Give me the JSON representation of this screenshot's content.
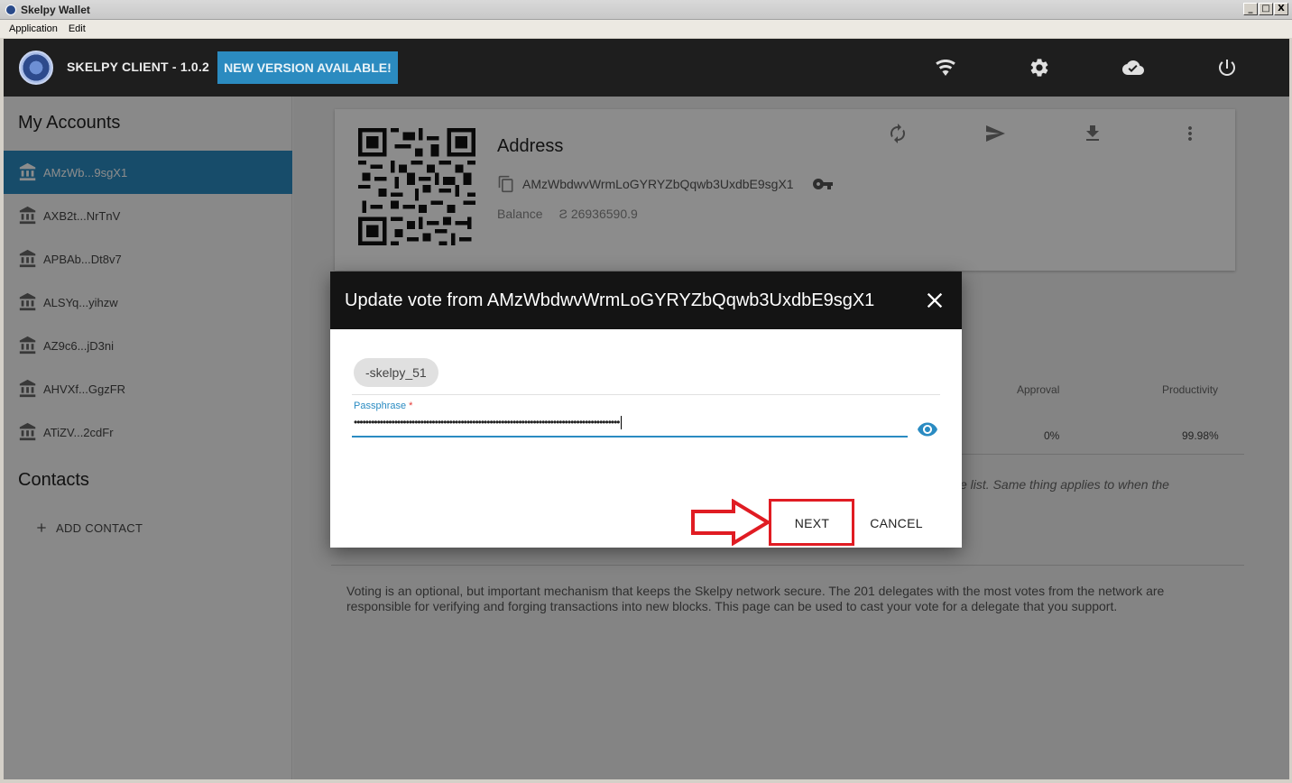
{
  "window": {
    "title": "Skelpy Wallet",
    "buttons": [
      "_",
      "□",
      "X"
    ]
  },
  "menubar": {
    "items": [
      "Application",
      "Edit"
    ]
  },
  "header": {
    "client_title": "SKELPY CLIENT - 1.0.2",
    "new_version_label": "NEW VERSION AVAILABLE!",
    "icons": [
      "wifi-icon",
      "settings-icon",
      "cloud-done-icon",
      "power-icon"
    ]
  },
  "sidebar": {
    "accounts_title": "My Accounts",
    "accounts": [
      {
        "label": "AMzWb...9sgX1",
        "active": true
      },
      {
        "label": "AXB2t...NrTnV",
        "active": false
      },
      {
        "label": "APBAb...Dt8v7",
        "active": false
      },
      {
        "label": "ALSYq...yihzw",
        "active": false
      },
      {
        "label": "AZ9c6...jD3ni",
        "active": false
      },
      {
        "label": "AHVXf...GgzFR",
        "active": false
      },
      {
        "label": "ATiZV...2cdFr",
        "active": false
      }
    ],
    "contacts_title": "Contacts",
    "add_contact_label": "ADD CONTACT"
  },
  "card": {
    "address_title": "Address",
    "address": "AMzWbdwvWrmLoGYRYZbQqwb3UxdbE9sgX1",
    "balance_label": "Balance",
    "balance_value": "Ƨ 26936590.9"
  },
  "table": {
    "headers": {
      "approval": "Approval",
      "productivity": "Productivity"
    },
    "row": {
      "approval": "0%",
      "productivity": "99.98%"
    }
  },
  "note_text": "ve list. Same thing applies to when the",
  "vote_info": "Voting is an optional, but important mechanism that keeps the Skelpy network secure. The 201 delegates with the most votes from the network are responsible for verifying and forging transactions into new blocks. This page can be used to cast your vote for a delegate that you support.",
  "dialog": {
    "title": "Update vote from AMzWbdwvWrmLoGYRYZbQqwb3UxdbE9sgX1",
    "chip_label": "-skelpy_51",
    "passphrase_label": "Passphrase",
    "passphrase_required_mark": "*",
    "passphrase_value": "••••••••••••••••••••••••••••••••••••••••••••••••••••••••••••••••••••••••••••••••••••••••••••",
    "next_label": "NEXT",
    "cancel_label": "CANCEL"
  },
  "colors": {
    "accent": "#2a8bc2",
    "header_bg": "#1e1e1e",
    "dialog_header_bg": "#141414",
    "highlight_red": "#e01c23"
  }
}
